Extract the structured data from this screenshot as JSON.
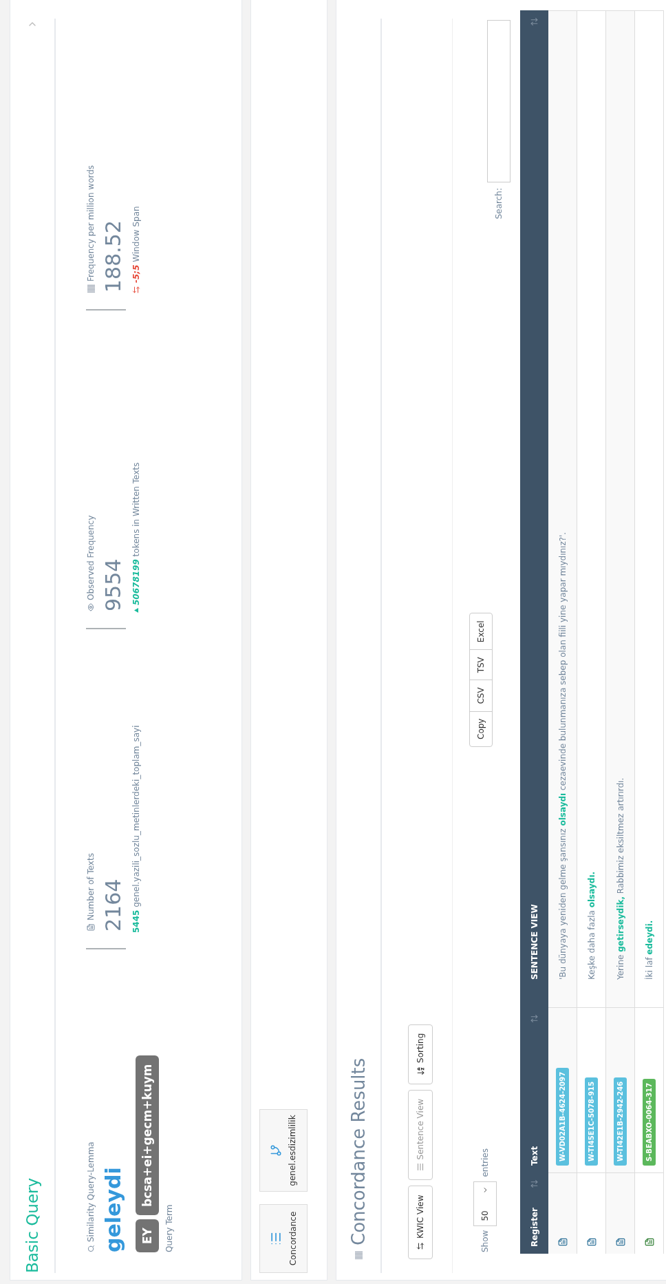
{
  "basic_query": {
    "title": "Basic Query",
    "query": {
      "label": "Similarity Query-Lemma",
      "lemma": "geleydi",
      "tags": [
        "EY",
        "bcsa+ei+gecm+kuym"
      ],
      "caption": "Query Term"
    },
    "stats": [
      {
        "kind": "count",
        "label": "Number of Texts",
        "value": "2164",
        "note": "**5445** genel.yazili_sozlu_metinlerdeki_toplam_sayi"
      },
      {
        "kind": "tokens",
        "label": "Observed Frequency",
        "value": "9554",
        "note": "*50678199* tokens in Written Texts"
      },
      {
        "kind": "span",
        "label": "Frequency per million words",
        "value": "188.52",
        "note": "*-5;5* Window Span"
      }
    ]
  },
  "tools": [
    {
      "kind": "list",
      "label": "Concordance"
    },
    {
      "kind": "branch",
      "label": "genel.esdizimlilik"
    }
  ],
  "concordance": {
    "title": "Concordance Results",
    "view_buttons": [
      {
        "kind": "kwic",
        "label": "KWIC View",
        "disabled": false
      },
      {
        "kind": "sentence",
        "label": "Sentence View",
        "disabled": true
      },
      {
        "kind": "sort",
        "label": "Sorting",
        "disabled": false
      }
    ],
    "length": {
      "before": "Show",
      "value": "50",
      "after": "entries"
    },
    "exports": [
      "Copy",
      "CSV",
      "TSV",
      "Excel"
    ],
    "search": {
      "label": "Search:"
    },
    "table": {
      "columns": [
        "Register",
        "Text",
        "SENTENCE VIEW"
      ],
      "rows": [
        {
          "kind": "written",
          "code": "W-VD02A1B-4624-2097",
          "color": "#5bc0de",
          "sentence": "'Bu dünyaya yeniden gelme şansınız **olsaydı** cezaevinde bulunmanıza sebep olan fiili yine yapar mıydınız?'."
        },
        {
          "kind": "written",
          "code": "W-TI45E1C-5078-915",
          "color": "#5bc0de",
          "sentence": "Keşke daha fazla **olsaydı.**"
        },
        {
          "kind": "written",
          "code": "W-TI42E1B-2942-246",
          "color": "#5bc0de",
          "sentence": "Yerine **getirseydik,** Rabbimiz eksiltmez artırırdı."
        },
        {
          "kind": "spoken",
          "code": "S-BEABXO-0064-317",
          "color": "#5cb85c",
          "sentence": "İki laf **edeydi.**"
        }
      ]
    }
  }
}
